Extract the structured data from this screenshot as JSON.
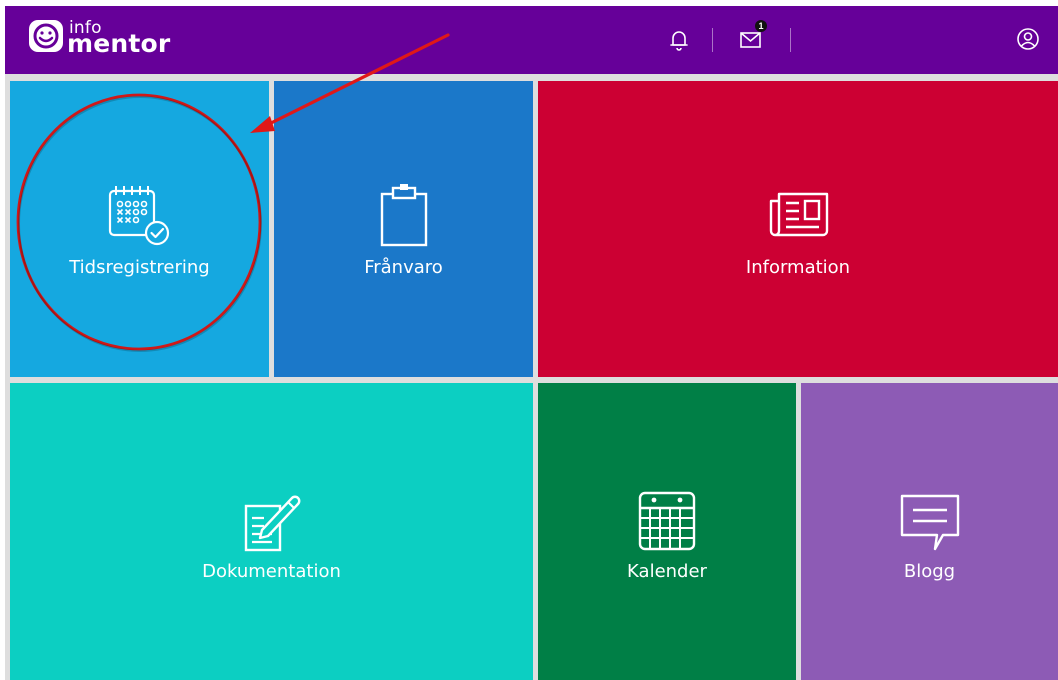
{
  "header": {
    "logo_small": "info",
    "logo_big": "mentor",
    "message_count": "1"
  },
  "tiles": {
    "tidsregistrering": {
      "label": "Tidsregistrering",
      "color": "#15a8e0"
    },
    "franvaro": {
      "label": "Frånvaro",
      "color": "#1b78c9"
    },
    "information": {
      "label": "Information",
      "color": "#cc0033"
    },
    "dokumentation": {
      "label": "Dokumentation",
      "color": "#0ccfc2"
    },
    "kalender": {
      "label": "Kalender",
      "color": "#007f46"
    },
    "blogg": {
      "label": "Blogg",
      "color": "#8d5bb5"
    }
  },
  "colors": {
    "topbar": "#660099",
    "annotation": "#e01818"
  }
}
